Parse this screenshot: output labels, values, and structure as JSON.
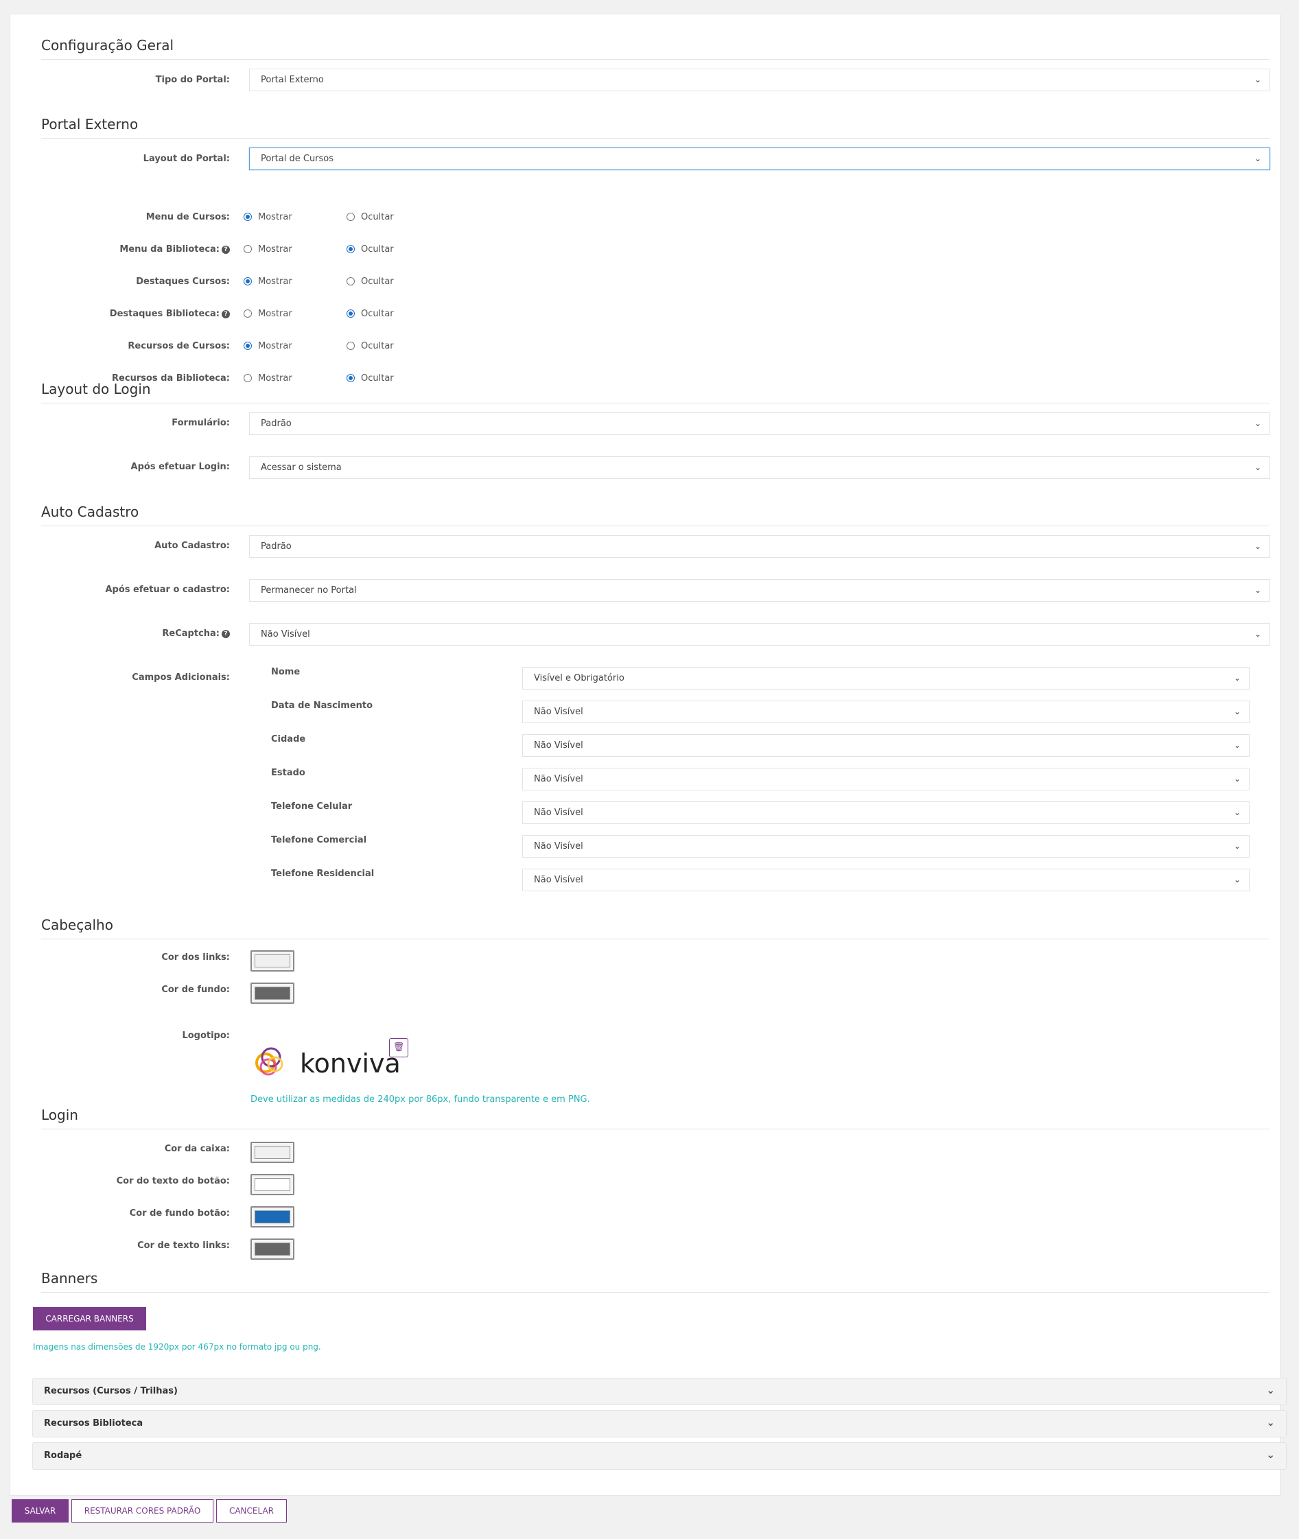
{
  "sections": {
    "geral": "Configuração Geral",
    "portal_externo": "Portal Externo",
    "layout_login": "Layout do Login",
    "auto_cadastro": "Auto Cadastro",
    "cabecalho": "Cabeçalho",
    "login": "Login",
    "banners": "Banners"
  },
  "geral": {
    "tipo_label": "Tipo do Portal:",
    "tipo_value": "Portal Externo"
  },
  "portal_externo": {
    "layout_label": "Layout do Portal:",
    "layout_value": "Portal de Cursos",
    "show_label": "Mostrar",
    "hide_label": "Ocultar",
    "toggles": [
      {
        "label": "Menu de Cursos:",
        "selected": "Mostrar"
      },
      {
        "label": "Menu da Biblioteca:",
        "selected": "Ocultar"
      },
      {
        "label": "Destaques Cursos:",
        "selected": "Mostrar"
      },
      {
        "label": "Destaques Biblioteca:",
        "selected": "Ocultar"
      },
      {
        "label": "Recursos de Cursos:",
        "selected": "Mostrar"
      },
      {
        "label": "Recursos da Biblioteca:",
        "selected": "Ocultar"
      }
    ]
  },
  "layout_login": {
    "formulario_label": "Formulário:",
    "formulario_value": "Padrão",
    "apos_login_label": "Após efetuar Login:",
    "apos_login_value": "Acessar o sistema"
  },
  "auto_cadastro": {
    "auto_label": "Auto Cadastro:",
    "auto_value": "Padrão",
    "apos_cadastro_label": "Após efetuar o cadastro:",
    "apos_cadastro_value": "Permanecer no Portal",
    "recaptcha_label": "ReCaptcha:",
    "recaptcha_value": "Não Visível",
    "campos_label": "Campos Adicionais:",
    "campos": [
      {
        "name": "Nome",
        "value": "Visível e Obrigatório"
      },
      {
        "name": "Data de Nascimento",
        "value": "Não Visível"
      },
      {
        "name": "Cidade",
        "value": "Não Visível"
      },
      {
        "name": "Estado",
        "value": "Não Visível"
      },
      {
        "name": "Telefone Celular",
        "value": "Não Visível"
      },
      {
        "name": "Telefone Comercial",
        "value": "Não Visível"
      },
      {
        "name": "Telefone Residencial",
        "value": "Não Visível"
      }
    ]
  },
  "cabecalho": {
    "cor_links_label": "Cor dos links:",
    "cor_links_color": "#f0f0f0",
    "cor_fundo_label": "Cor de fundo:",
    "cor_fundo_color": "#666666",
    "logotipo_label": "Logotipo:",
    "logo_text": "konviva",
    "logo_hint": "Deve utilizar as medidas de 240px por 86px, fundo transparente e em PNG."
  },
  "login": {
    "cor_caixa_label": "Cor da caixa:",
    "cor_caixa_color": "#f0f0f0",
    "cor_texto_botao_label": "Cor do texto do botão:",
    "cor_texto_botao_color": "#ffffff",
    "cor_fundo_botao_label": "Cor de fundo botão:",
    "cor_fundo_botao_color": "#1a6ab8",
    "cor_texto_links_label": "Cor de texto links:",
    "cor_texto_links_color": "#666666"
  },
  "banners": {
    "button_label": "CARREGAR BANNERS",
    "hint": "Imagens nas dimensões de 1920px por 467px no formato jpg ou png."
  },
  "accordions": [
    {
      "title": "Recursos (Cursos / Trilhas)"
    },
    {
      "title": "Recursos Biblioteca"
    },
    {
      "title": "Rodapé"
    }
  ],
  "footer": {
    "save": "SALVAR",
    "restore": "RESTAURAR CORES PADRÃO",
    "cancel": "CANCELAR"
  },
  "colors": {
    "accent": "#7a3b8b",
    "teal_hint": "#26b5b5",
    "radio": "#1a6fc4"
  }
}
